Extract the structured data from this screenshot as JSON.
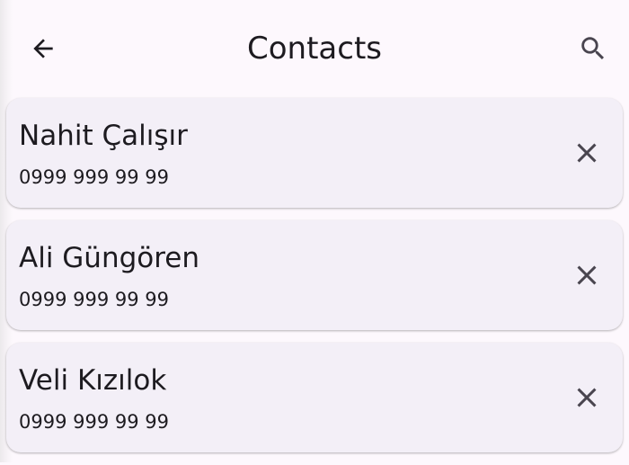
{
  "app_bar": {
    "title": "Contacts",
    "back_icon": "arrow-back-icon",
    "search_icon": "search-icon"
  },
  "contacts": [
    {
      "name": "Nahit Çalışır",
      "phone": "0999 999 99 99"
    },
    {
      "name": "Ali Güngören",
      "phone": "0999 999 99 99"
    },
    {
      "name": "Veli Kızılok",
      "phone": "0999 999 99 99"
    }
  ],
  "colors": {
    "background": "#fdf8fd",
    "card": "#f3eff7",
    "text": "#1d1b20",
    "icon": "#49454f"
  }
}
